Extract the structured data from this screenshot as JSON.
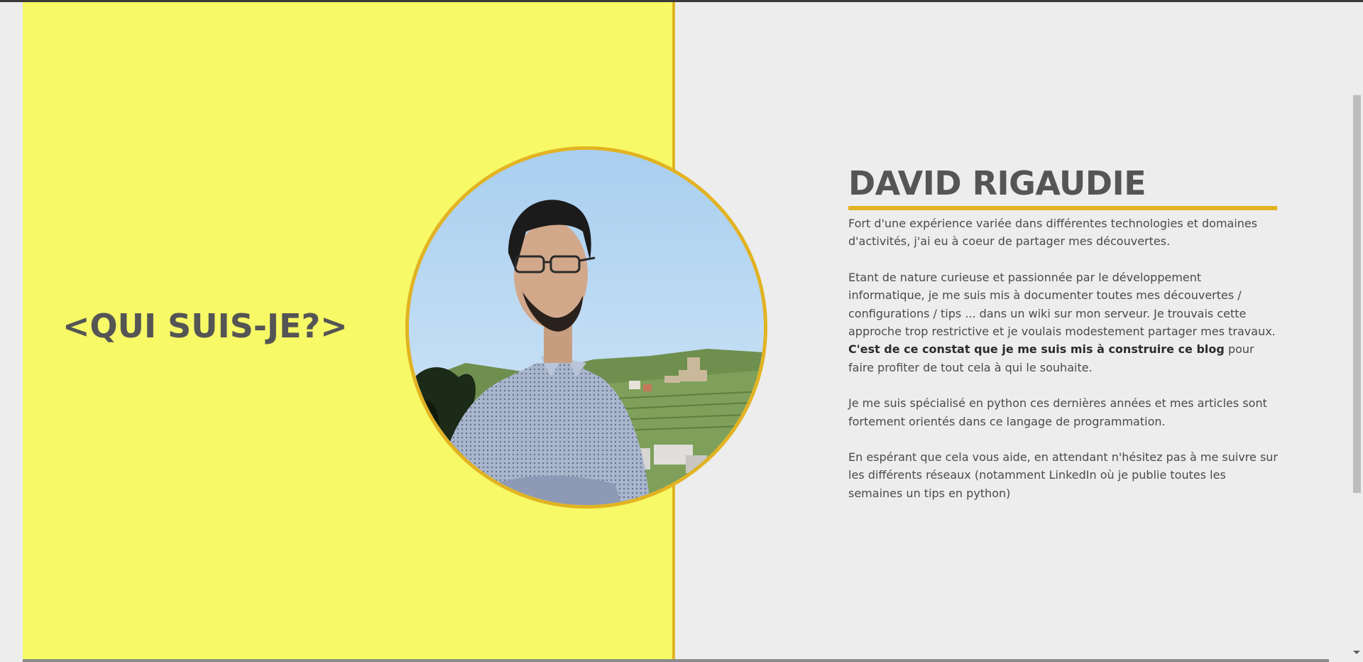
{
  "section": {
    "heading": "<QUI SUIS-JE?>"
  },
  "bio": {
    "name": "DAVID RIGAUDIE",
    "p1": "Fort d'une expérience variée dans différentes technologies et domaines d'activités, j'ai eu à coeur de partager mes découvertes.",
    "p2_start": "Etant de nature curieuse et passionnée par le développement informatique, je me suis mis à documenter toutes mes découvertes / configurations / tips ... dans un wiki sur mon serveur. Je trouvais cette approche trop restrictive et je voulais modestement partager mes travaux. ",
    "p2_bold": "C'est de ce constat que je me suis mis à construire ce blog",
    "p2_end": " pour faire profiter de tout cela à qui le souhaite.",
    "p3": "Je me suis spécialisé en python ces dernières années et mes articles sont fortement orientés dans ce langage de programmation.",
    "p4": "En espérant que cela vous aide, en attendant n'hésitez pas à me suivre sur les différents réseaux (notamment LinkedIn où je publie toutes les semaines un tips en python)"
  },
  "colors": {
    "panel_yellow": "#f7f966",
    "accent_gold": "#e2b322",
    "heading_gray": "#555555",
    "background": "#ededed"
  }
}
